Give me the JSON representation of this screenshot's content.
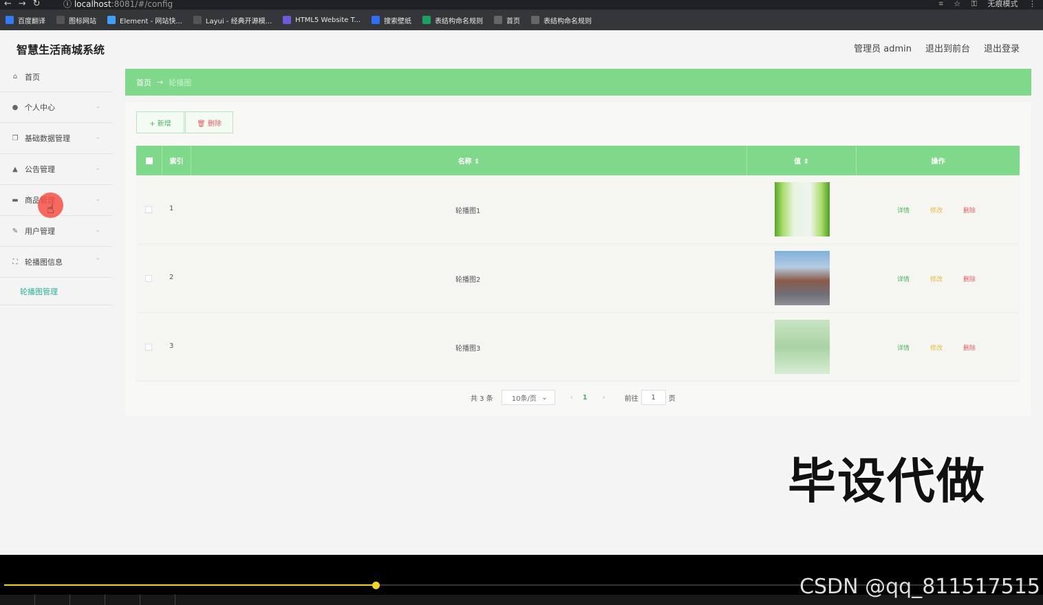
{
  "browser": {
    "url_host": "localhost",
    "url_path": ":8081/#/config",
    "right_label": "无痕模式",
    "bookmarks": [
      {
        "label": "百度翻译",
        "icon": "translate-icon",
        "color": "#2f7cf6"
      },
      {
        "label": "图标网站",
        "icon": "folder-icon",
        "color": "#555"
      },
      {
        "label": "Element - 网站快...",
        "icon": "element-icon",
        "color": "#409eff"
      },
      {
        "label": "Layui - 经典开源模...",
        "icon": "layui-icon",
        "color": "#555"
      },
      {
        "label": "HTML5 Website T...",
        "icon": "html5-icon",
        "color": "#6b5bd6"
      },
      {
        "label": "搜索壁纸",
        "icon": "wallpaper-icon",
        "color": "#2f6ef6"
      },
      {
        "label": "表结构命名规则",
        "icon": "sheet-icon",
        "color": "#1aa260"
      },
      {
        "label": "首页",
        "icon": "globe-icon",
        "color": "#666"
      },
      {
        "label": "表结构命名规则",
        "icon": "globe-icon",
        "color": "#666"
      }
    ]
  },
  "app": {
    "brand": "智慧生活商城系统",
    "topnav": {
      "admin": "管理员 admin",
      "front": "退出到前台",
      "logout": "退出登录"
    },
    "sidebar": [
      {
        "label": "首页",
        "icon": "home-icon",
        "chev": ""
      },
      {
        "label": "个人中心",
        "icon": "user-icon",
        "chev": "⌄"
      },
      {
        "label": "基础数据管理",
        "icon": "copy-icon",
        "chev": "⌄"
      },
      {
        "label": "公告管理",
        "icon": "thumb-icon",
        "chev": "⌄"
      },
      {
        "label": "商品管理",
        "icon": "monitor-icon",
        "chev": "⌄"
      },
      {
        "label": "用户管理",
        "icon": "pen-icon",
        "chev": "⌄"
      },
      {
        "label": "轮播图信息",
        "icon": "fullscreen-icon",
        "chev": "⌃"
      }
    ],
    "submenu": "轮播图管理",
    "breadcrumb": {
      "home": "首页",
      "arrow": "→",
      "current": "轮播图"
    },
    "buttons": {
      "add": "+ 新增",
      "delete": "🗑 删除"
    },
    "table": {
      "headers": {
        "index": "索引",
        "name": "名称 ⇕",
        "value": "值 ⇕",
        "ops": "操作"
      },
      "rows": [
        {
          "index": "1",
          "name": "轮播图1",
          "thumb": "bamboo"
        },
        {
          "index": "2",
          "name": "轮播图2",
          "thumb": "tower"
        },
        {
          "index": "3",
          "name": "轮播图3",
          "thumb": "mist"
        }
      ],
      "ops": {
        "detail": "详情",
        "edit": "修改",
        "delete": "删除"
      }
    },
    "pager": {
      "total": "共 3 条",
      "size": "10条/页",
      "prev": "‹",
      "page": "1",
      "next": "›",
      "goto": "前往",
      "goto_value": "1",
      "unit": "页"
    }
  },
  "watermark": "毕设代做",
  "player": {
    "csdn": "CSDN @qq_811517515",
    "progress": 0.36
  }
}
